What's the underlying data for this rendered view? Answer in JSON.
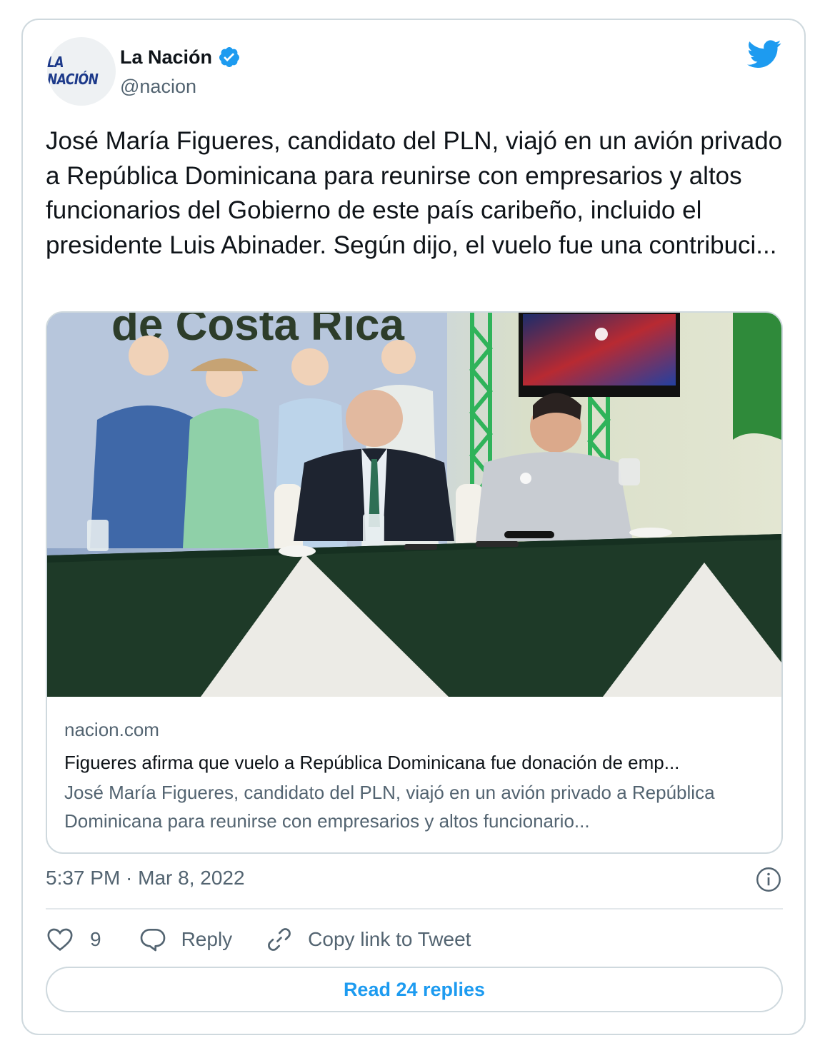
{
  "account": {
    "avatar_text": "LA NACIÓN",
    "name": "La Nación",
    "handle": "@nacion",
    "verified": true
  },
  "tweet": {
    "text": "José María Figueres, candidato del PLN, viajó en un avión privado a República Dominicana para reunirse con empresarios y altos funcionarios del Gobierno de este país caribeño, incluido el presidente Luis Abinader. Según dijo, el vuelo fue una contribuci..."
  },
  "link_card": {
    "photo_banner_text": "de Costa Rica",
    "domain": "nacion.com",
    "title": "Figueres afirma que vuelo a República Dominicana fue donación de emp...",
    "description": "José María Figueres, candidato del PLN, viajó en un avión privado a República Dominicana para reunirse con empresarios y altos funcionario..."
  },
  "timestamp": "5:37 PM · Mar 8, 2022",
  "actions": {
    "like_count": "9",
    "reply_label": "Reply",
    "copy_link_label": "Copy link to Tweet"
  },
  "read_replies_label": "Read 24 replies",
  "icons": {
    "brand": "twitter-bird-icon",
    "verified": "verified-badge-icon",
    "info": "info-icon",
    "like": "heart-icon",
    "reply": "speech-bubble-icon",
    "copy": "link-icon"
  },
  "colors": {
    "twitter_blue": "#1d9bf0",
    "text_primary": "#0f1419",
    "text_secondary": "#536471",
    "border": "#cfd9de",
    "tablecloth_green": "#1e3a28"
  }
}
